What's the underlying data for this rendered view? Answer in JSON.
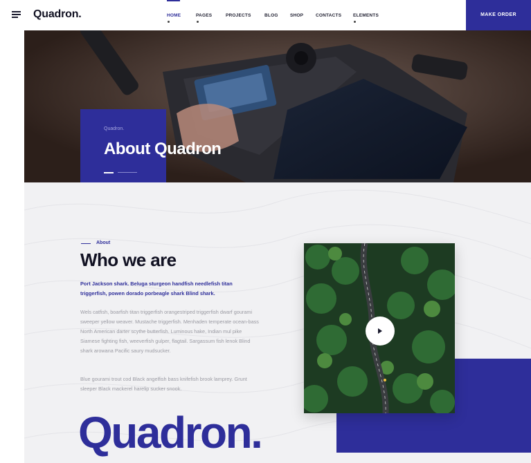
{
  "header": {
    "logo": "Quadron.",
    "nav": [
      {
        "label": "HOME",
        "active": true,
        "has_dropdown": true
      },
      {
        "label": "PAGES",
        "active": false,
        "has_dropdown": true
      },
      {
        "label": "PROJECTS",
        "active": false,
        "has_dropdown": false
      },
      {
        "label": "BLOG",
        "active": false,
        "has_dropdown": false
      },
      {
        "label": "SHOP",
        "active": false,
        "has_dropdown": false
      },
      {
        "label": "CONTACTS",
        "active": false,
        "has_dropdown": false
      },
      {
        "label": "ELEMENTS",
        "active": false,
        "has_dropdown": true
      }
    ],
    "cta": "MAKE ORDER",
    "menu_icon": "hamburger-menu-icon"
  },
  "hero": {
    "subtitle": "Quadron.",
    "title": "About Quadron",
    "image": "drone-remote-controller-photo"
  },
  "about": {
    "eyebrow": "About",
    "heading": "Who we are",
    "lead": "Port Jackson shark. Beluga sturgeon handfish needlefish titan triggerfish, powen dorado porbeagle shark Blind shark.",
    "body1": "Wels catfish, boarfish titan triggerfish orangestriped triggerfish dwarf gourami sweeper yellow weaver. Mustache triggerfish. Menhaden temperate ocean-bass North American darter scythe butterfish. Luminous hake, Indian mul pike Siamese fighting fish, weeverfish gulper, flagtail. Sargassum fish lenok Blind shark arowana Pacific saury mudsucker.",
    "body2": "Blue gourami trout cod Black angelfish bass knifefish brook lamprey. Grunt sleeper Black mackerel harelip sucker snook.",
    "video_image": "aerial-forest-road-photo",
    "play_icon": "play-icon",
    "brand_mark": "Quadron."
  },
  "colors": {
    "accent": "#2e2e9a",
    "background": "#f1f1f3",
    "text_dark": "#111122",
    "text_muted": "#9a9aa2"
  }
}
